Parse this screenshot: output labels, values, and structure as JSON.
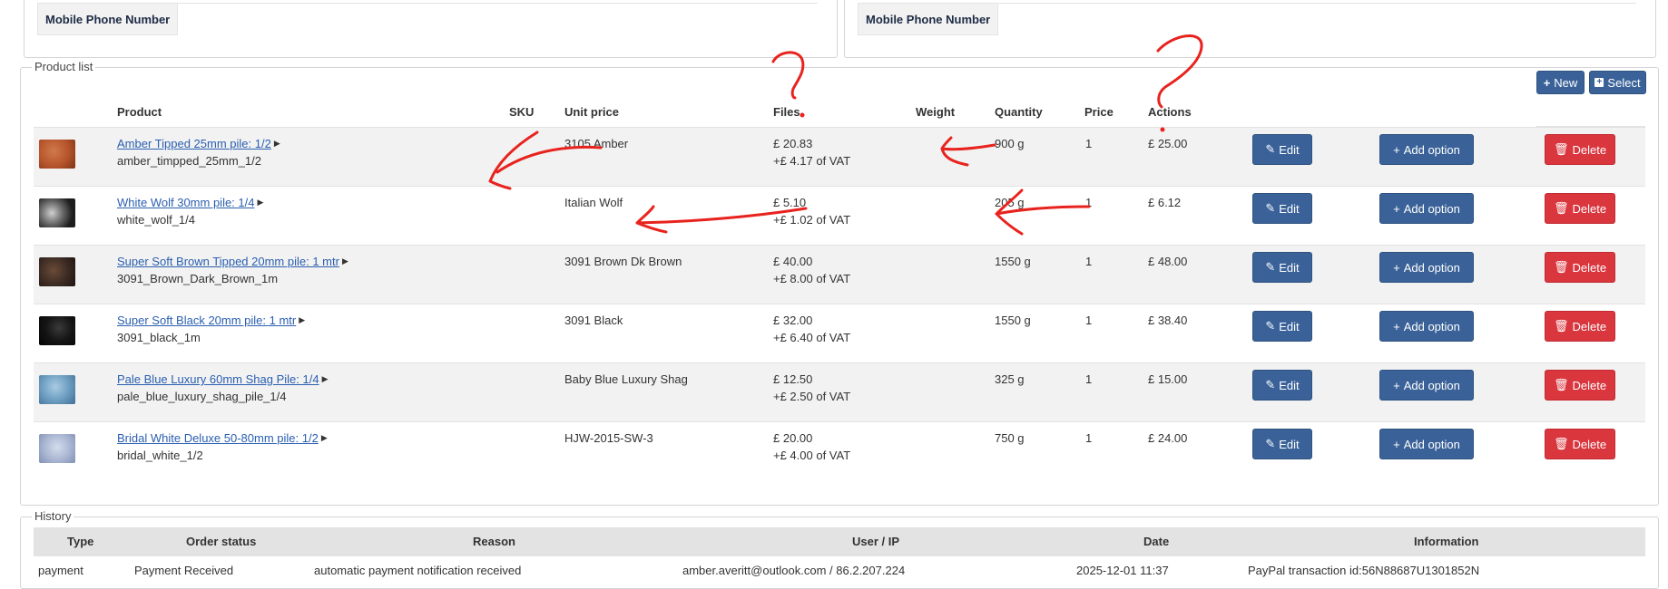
{
  "top_left": {
    "phone_label": "Mobile Phone Number"
  },
  "top_right": {
    "phone_label": "Mobile Phone Number"
  },
  "product_list": {
    "legend": "Product list",
    "new_label": "New",
    "select_label": "Select",
    "headers": {
      "product": "Product",
      "sku": "SKU",
      "unit_price": "Unit price",
      "files": "Files",
      "weight": "Weight",
      "quantity": "Quantity",
      "price": "Price",
      "actions": "Actions"
    },
    "edit_label": "Edit",
    "add_option_label": "Add option",
    "delete_label": "Delete",
    "rows": [
      {
        "name": "Amber Tipped 25mm pile: 1/2",
        "code": "amber_timpped_25mm_1/2",
        "sku": "",
        "unit_desc": "3105 Amber",
        "unit_price": "£ 20.83",
        "vat": "+£ 4.17 of VAT",
        "weight": "900 g",
        "quantity": "1",
        "price": "£ 25.00",
        "thumb_color": "#b5532b"
      },
      {
        "name": "White Wolf 30mm pile: 1/4",
        "code": "white_wolf_1/4",
        "sku": "",
        "unit_desc": "Italian Wolf",
        "unit_price": "£ 5.10",
        "vat": "+£ 1.02 of VAT",
        "weight": "205 g",
        "quantity": "1",
        "price": "£ 6.12",
        "thumb_color": "#5a5a5a"
      },
      {
        "name": "Super Soft Brown Tipped 20mm pile: 1 mtr",
        "code": "3091_Brown_Dark_Brown_1m",
        "sku": "",
        "unit_desc": "3091 Brown Dk Brown",
        "unit_price": "£ 40.00",
        "vat": "+£ 8.00 of VAT",
        "weight": "1550 g",
        "quantity": "1",
        "price": "£ 48.00",
        "thumb_color": "#3b2a22"
      },
      {
        "name": "Super Soft Black 20mm pile: 1 mtr",
        "code": "3091_black_1m",
        "sku": "",
        "unit_desc": "3091 Black",
        "unit_price": "£ 32.00",
        "vat": "+£ 6.40 of VAT",
        "weight": "1550 g",
        "quantity": "1",
        "price": "£ 38.40",
        "thumb_color": "#151515"
      },
      {
        "name": "Pale Blue Luxury 60mm Shag Pile: 1/4",
        "code": "pale_blue_luxury_shag_pile_1/4",
        "sku": "",
        "unit_desc": "Baby Blue Luxury Shag",
        "unit_price": "£ 12.50",
        "vat": "+£ 2.50 of VAT",
        "weight": "325 g",
        "quantity": "1",
        "price": "£ 15.00",
        "thumb_color": "#6f9fc2"
      },
      {
        "name": "Bridal White Deluxe 50-80mm pile: 1/2",
        "code": "bridal_white_1/2",
        "sku": "",
        "unit_desc": "HJW-2015-SW-3",
        "unit_price": "£ 20.00",
        "vat": "+£ 4.00 of VAT",
        "weight": "750 g",
        "quantity": "1",
        "price": "£ 24.00",
        "thumb_color": "#a9b6d2"
      }
    ]
  },
  "history": {
    "legend": "History",
    "headers": {
      "type": "Type",
      "order_status": "Order status",
      "reason": "Reason",
      "user_ip": "User / IP",
      "date": "Date",
      "information": "Information"
    },
    "rows": [
      {
        "type": "payment",
        "order_status": "Payment Received",
        "reason": "automatic payment notification received",
        "user_ip": "amber.averitt@outlook.com / 86.2.207.224",
        "date": "2025-12-01 11:37",
        "information": "PayPal transaction id:56N88687U1301852N"
      }
    ]
  },
  "colors": {
    "primary_button": "#3a6299",
    "danger_button": "#d9363e",
    "link": "#2a5fb0",
    "annotation": "#e8231e"
  }
}
